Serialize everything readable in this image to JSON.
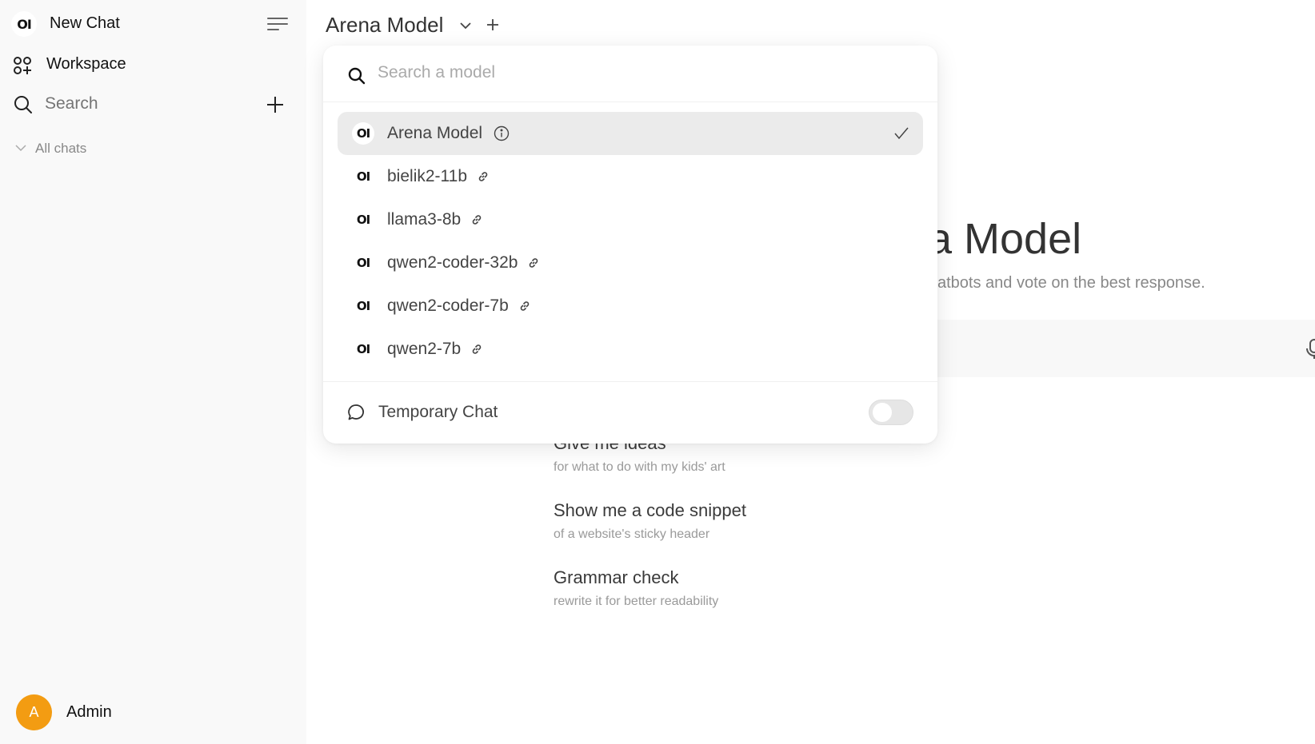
{
  "sidebar": {
    "new_chat_label": "New Chat",
    "logo_text": "OI",
    "workspace_label": "Workspace",
    "search_placeholder": "Search",
    "all_chats_label": "All chats",
    "user": {
      "avatar_initial": "A",
      "name": "Admin",
      "avatar_color": "#f39c12"
    }
  },
  "header": {
    "model_title": "Arena Model"
  },
  "model_dropdown": {
    "search_placeholder": "Search a model",
    "models": [
      {
        "name": "Arena Model",
        "logo": "OI",
        "selected": true,
        "icon": "info-icon"
      },
      {
        "name": "bielik2-11b",
        "logo": "OI",
        "selected": false,
        "icon": "link-icon"
      },
      {
        "name": "llama3-8b",
        "logo": "OI",
        "selected": false,
        "icon": "link-icon"
      },
      {
        "name": "qwen2-coder-32b",
        "logo": "OI",
        "selected": false,
        "icon": "link-icon"
      },
      {
        "name": "qwen2-coder-7b",
        "logo": "OI",
        "selected": false,
        "icon": "link-icon"
      },
      {
        "name": "qwen2-7b",
        "logo": "OI",
        "selected": false,
        "icon": "link-icon"
      }
    ],
    "temporary_chat": {
      "label": "Temporary Chat",
      "enabled": false
    }
  },
  "main": {
    "welcome_title_visible": "a Model",
    "welcome_subtitle_visible": "atbots and vote on the best response.",
    "suggestions": [
      {
        "title": "Give me ideas",
        "subtitle": "for what to do with my kids' art"
      },
      {
        "title": "Show me a code snippet",
        "subtitle": "of a website's sticky header"
      },
      {
        "title": "Grammar check",
        "subtitle": "rewrite it for better readability"
      }
    ]
  }
}
